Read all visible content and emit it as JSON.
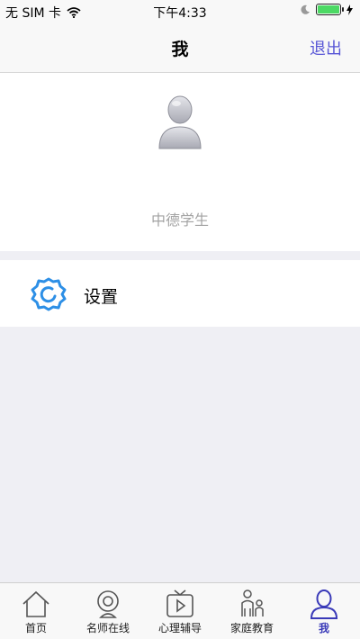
{
  "status_bar": {
    "carrier": "无 SIM 卡",
    "time": "下午4:33",
    "battery_level": 1.0
  },
  "nav": {
    "title": "我",
    "logout_label": "退出"
  },
  "profile": {
    "username": "中德学生",
    "avatar_icon": "user-avatar-icon"
  },
  "settings": {
    "label": "设置",
    "icon": "gear-icon",
    "icon_color": "#2d8fe6"
  },
  "tabs": [
    {
      "label": "首页",
      "icon": "home-icon"
    },
    {
      "label": "名师在线",
      "icon": "webcam-icon"
    },
    {
      "label": "心理辅导",
      "icon": "tv-play-icon"
    },
    {
      "label": "家庭教育",
      "icon": "family-icon"
    },
    {
      "label": "我",
      "icon": "person-icon",
      "active": true
    }
  ],
  "colors": {
    "accent": "#5856d6",
    "active_tab": "#3a3ab8",
    "background": "#efeff4"
  }
}
